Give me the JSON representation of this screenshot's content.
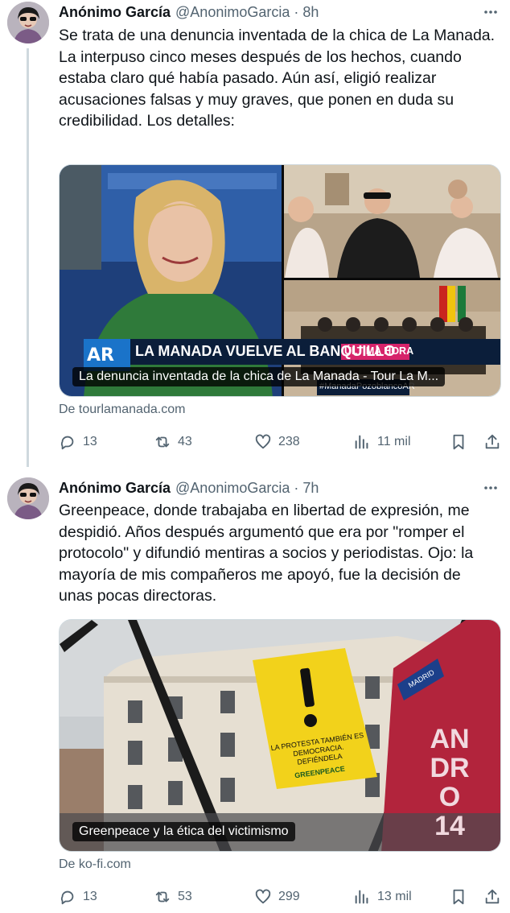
{
  "tweets": [
    {
      "name": "Anónimo García",
      "handle": "@AnonimoGarcia",
      "separator": "·",
      "time": "8h",
      "text": "Se trata de una denuncia inventada de la chica de La Manada.\nLa interpuso cinco meses después de los hechos, cuando estaba claro qué había pasado. Aún así, eligió realizar acusaciones falsas y muy graves, que ponen en duda su credibilidad. Los detalles:",
      "card": {
        "caption": "La denuncia inventada de la chica de La Manada - Tour La M...",
        "banner_logo": "AR",
        "banner_title": "LA MANADA VUELVE AL BANQUILLO",
        "banner_tag": "ÚLTIMA HORA",
        "banner_hashtag": "#ManadaPozoblancoAR"
      },
      "source": "De tourlamanada.com",
      "stats": {
        "replies": "13",
        "reposts": "43",
        "likes": "238",
        "views": "11 mil"
      }
    },
    {
      "name": "Anónimo García",
      "handle": "@AnonimoGarcia",
      "separator": "·",
      "time": "7h",
      "text": "Greenpeace, donde trabajaba en libertad de expresión, me despidió. Años después argumentó que era por \"romper el protocolo\" y difundió mentiras a socios y periodistas. Ojo: la mayoría de mis compañeros me apoyó, fue la decisión de unas pocas directoras.",
      "card": {
        "caption": "Greenpeace y la ética del victimismo",
        "banner_text": "LA PROTESTA TAMBIÉN ES DEMOCRACIA. DEFIÉNDELA",
        "banner_brand": "GREENPEACE",
        "sign_text": "MADRID",
        "mural_text": "AN DRO 14"
      },
      "source": "De ko-fi.com",
      "stats": {
        "replies": "13",
        "reposts": "53",
        "likes": "299",
        "views": "13 mil"
      }
    }
  ]
}
